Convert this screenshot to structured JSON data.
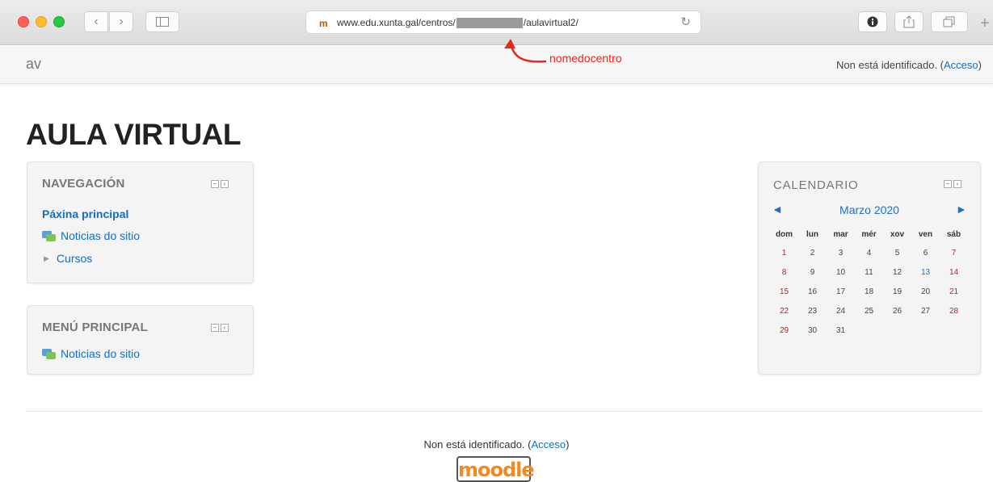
{
  "browser": {
    "url_before": "www.edu.xunta.gal/centros/",
    "url_after": "/aulavirtual2/",
    "back_icon": "chevron-left",
    "forward_icon": "chevron-right",
    "sidebar_icon": "sidebar",
    "reload_icon": "reload",
    "share_icon": "share",
    "tabs_icon": "tabs",
    "plus_icon": "plus"
  },
  "annotation": {
    "label": "nomedocentro",
    "color": "#e8261a"
  },
  "header": {
    "brand": "av",
    "login_text": "Non está identificado. (",
    "login_link": "Acceso",
    "login_close": ")"
  },
  "page": {
    "title": "AULA VIRTUAL"
  },
  "navigation": {
    "title": "NAVEGACIÓN",
    "home": "Páxina principal",
    "news": "Noticias do sitio",
    "courses": "Cursos"
  },
  "main_menu": {
    "title": "MENÚ PRINCIPAL",
    "news": "Noticias do sitio"
  },
  "calendar": {
    "title": "CALENDARIO",
    "month": "Marzo 2020",
    "prev": "◄",
    "next": "►",
    "weekdays": [
      "dom",
      "lun",
      "mar",
      "mér",
      "xov",
      "ven",
      "sáb"
    ],
    "weeks": [
      [
        "1",
        "2",
        "3",
        "4",
        "5",
        "6",
        "7"
      ],
      [
        "8",
        "9",
        "10",
        "11",
        "12",
        "13",
        "14"
      ],
      [
        "15",
        "16",
        "17",
        "18",
        "19",
        "20",
        "21"
      ],
      [
        "22",
        "23",
        "24",
        "25",
        "26",
        "27",
        "28"
      ],
      [
        "29",
        "30",
        "31",
        "",
        "",
        "",
        ""
      ]
    ],
    "highlight_day": "13"
  },
  "footer": {
    "login_text": "Non está identificado. (",
    "login_link": "Acceso",
    "login_close": ")",
    "logo": "moodle"
  }
}
